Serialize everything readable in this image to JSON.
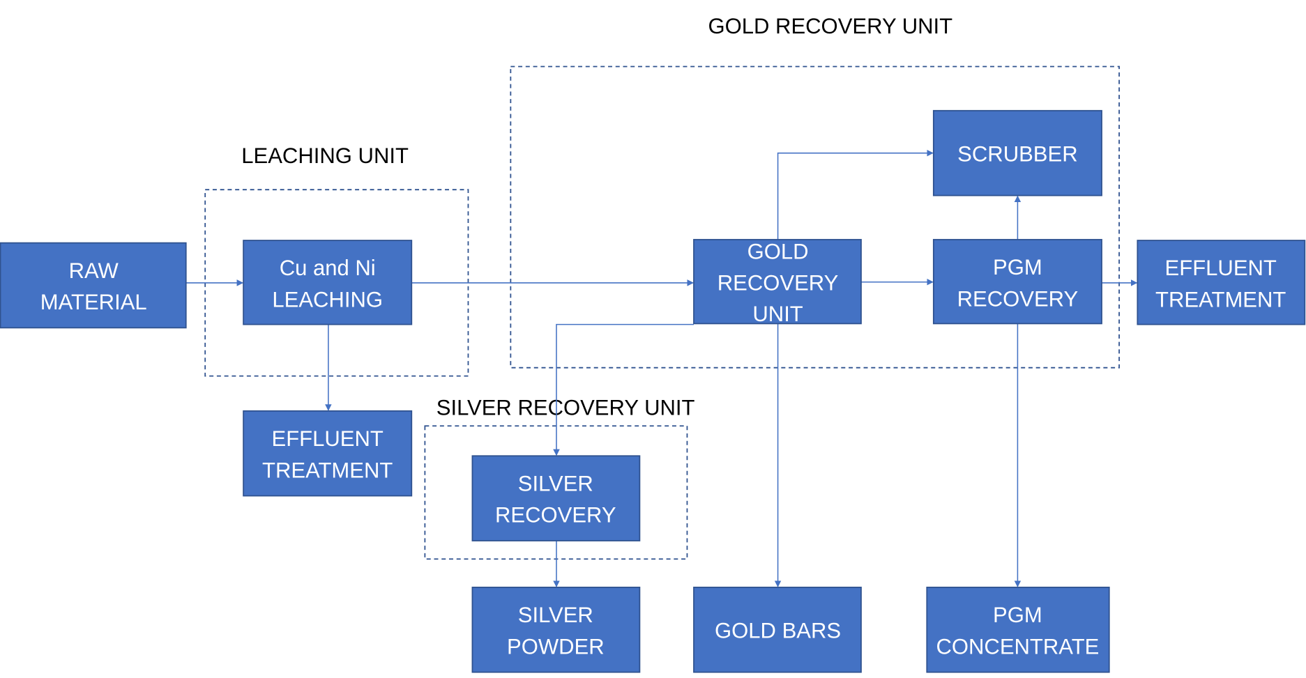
{
  "groups": {
    "leaching": "LEACHING UNIT",
    "silver": "SILVER RECOVERY UNIT",
    "gold": "GOLD RECOVERY UNIT"
  },
  "boxes": {
    "raw": [
      "RAW",
      "MATERIAL"
    ],
    "leach": [
      "Cu and Ni",
      "LEACHING"
    ],
    "effluent1": [
      "EFFLUENT",
      "TREATMENT"
    ],
    "silver_rec": [
      "SILVER",
      "RECOVERY"
    ],
    "silver_powder": [
      "SILVER",
      "POWDER"
    ],
    "gold_bars": [
      "GOLD BARS"
    ],
    "gold_rec": [
      "GOLD",
      "RECOVERY",
      "UNIT"
    ],
    "scrubber": [
      "SCRUBBER"
    ],
    "pgm_rec": [
      "PGM",
      "RECOVERY"
    ],
    "effluent2": [
      "EFFLUENT",
      "TREATMENT"
    ],
    "pgm_conc": [
      "PGM",
      "CONCENTRATE"
    ]
  },
  "colors": {
    "box_fill": "#4472C4",
    "box_border": "#2F528F",
    "arrow": "#4472C4"
  }
}
